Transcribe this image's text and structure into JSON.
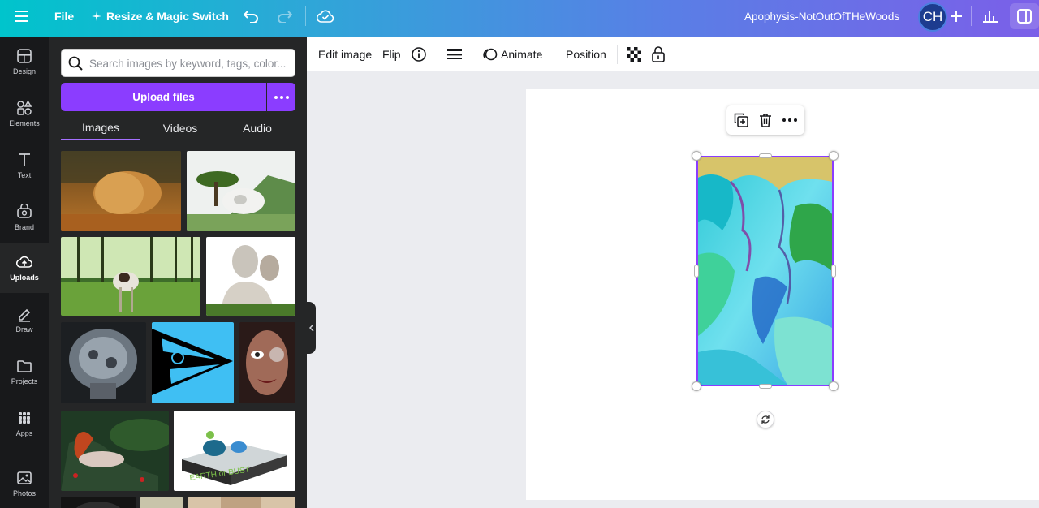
{
  "header": {
    "file_label": "File",
    "resize_label": "Resize & Magic Switch",
    "design_title": "Apophysis-NotOutOfTHeWoods",
    "avatar_initials": "CH",
    "icons": [
      "menu-icon",
      "sparkle-icon",
      "undo-icon",
      "redo-icon",
      "cloud-save-icon",
      "plus-icon",
      "analytics-icon",
      "share-panel-icon"
    ]
  },
  "rail": {
    "items": [
      {
        "label": "Design",
        "icon": "design-icon"
      },
      {
        "label": "Elements",
        "icon": "elements-icon"
      },
      {
        "label": "Text",
        "icon": "text-icon"
      },
      {
        "label": "Brand",
        "icon": "brand-icon"
      },
      {
        "label": "Uploads",
        "icon": "upload-cloud-icon",
        "active": true
      },
      {
        "label": "Draw",
        "icon": "draw-icon"
      },
      {
        "label": "Projects",
        "icon": "folder-icon"
      },
      {
        "label": "Apps",
        "icon": "apps-grid-icon"
      },
      {
        "label": "Photos",
        "icon": "photos-icon"
      }
    ]
  },
  "panel": {
    "search_placeholder": "Search images by keyword, tags, color...",
    "upload_label": "Upload files",
    "tabs": [
      {
        "label": "Images",
        "active": true
      },
      {
        "label": "Videos"
      },
      {
        "label": "Audio"
      }
    ]
  },
  "toolbar": {
    "edit_image": "Edit image",
    "flip": "Flip",
    "animate": "Animate",
    "position": "Position"
  },
  "colors": {
    "accent": "#8b3dff",
    "rail_bg": "#18191b",
    "panel_bg": "#252627"
  }
}
